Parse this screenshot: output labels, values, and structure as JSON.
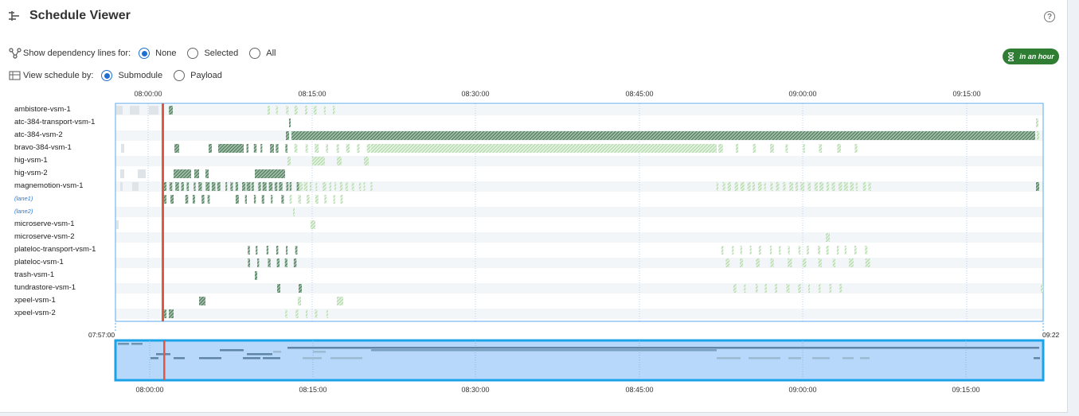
{
  "header": {
    "title": "Schedule Viewer",
    "help_icon": "help-circle-icon",
    "header_icon": "schedule-icon"
  },
  "dependency": {
    "label": "Show dependency lines for:",
    "options": [
      {
        "label": "None",
        "selected": true
      },
      {
        "label": "Selected",
        "selected": false
      },
      {
        "label": "All",
        "selected": false
      }
    ]
  },
  "view": {
    "label": "View schedule by:",
    "options": [
      {
        "label": "Submodule",
        "selected": true
      },
      {
        "label": "Payload",
        "selected": false
      }
    ]
  },
  "badge": {
    "label": "in an hour",
    "icon": "hourglass-icon",
    "color": "#2e7d32"
  },
  "time_ticks": [
    "08:00:00",
    "08:15:00",
    "08:30:00",
    "08:45:00",
    "09:00:00",
    "09:15:00"
  ],
  "range": {
    "start": "07:57:00",
    "end": "09:22"
  },
  "rows": [
    {
      "label": "ambistore-vsm-1",
      "lane": false
    },
    {
      "label": "atc-384-transport-vsm-1",
      "lane": false
    },
    {
      "label": "atc-384-vsm-2",
      "lane": false
    },
    {
      "label": "bravo-384-vsm-1",
      "lane": false
    },
    {
      "label": "hig-vsm-1",
      "lane": false
    },
    {
      "label": "hig-vsm-2",
      "lane": false
    },
    {
      "label": "magnemotion-vsm-1",
      "lane": false
    },
    {
      "label": "(lane1)",
      "lane": true
    },
    {
      "label": "(lane2)",
      "lane": true
    },
    {
      "label": "microserve-vsm-1",
      "lane": false
    },
    {
      "label": "microserve-vsm-2",
      "lane": false
    },
    {
      "label": "plateloc-transport-vsm-1",
      "lane": false
    },
    {
      "label": "plateloc-vsm-1",
      "lane": false
    },
    {
      "label": "trash-vsm-1",
      "lane": false
    },
    {
      "label": "tundrastore-vsm-1",
      "lane": false
    },
    {
      "label": "xpeel-vsm-1",
      "lane": false
    },
    {
      "label": "xpeel-vsm-2",
      "lane": false
    }
  ],
  "colors": {
    "done": "#3d6b4a",
    "pending": "#9ccf95",
    "past": "#dfe4e8",
    "now_line": "#e0583f",
    "selection_fill": "#b8d8fb",
    "selection_border": "#1aa3e8",
    "frame": "#5aa9ec"
  }
}
